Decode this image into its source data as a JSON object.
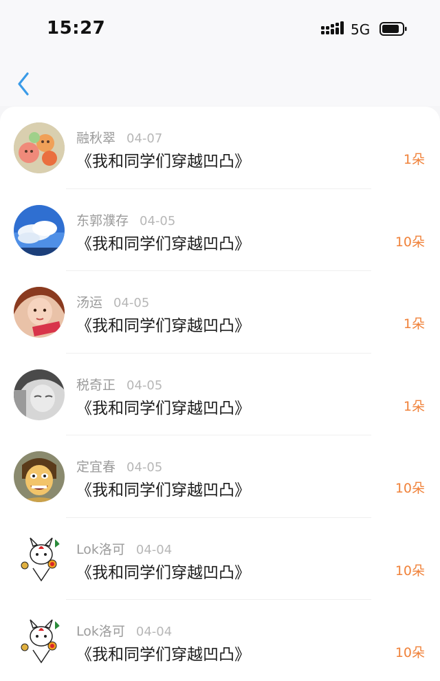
{
  "status_bar": {
    "time": "15:27",
    "network": "5G"
  },
  "nav": {
    "back_icon": "chevron-left-icon"
  },
  "colors": {
    "accent_back": "#3a9be8",
    "flower_count": "#f0823a",
    "username": "#9b9b9b",
    "date": "#b7b7b7"
  },
  "records": [
    {
      "username": "融秋翠",
      "date": "04-07",
      "title": "《我和同学们穿越凹凸》",
      "flowers": "1朵",
      "avatar": "avatar-1"
    },
    {
      "username": "东郭濮存",
      "date": "04-05",
      "title": "《我和同学们穿越凹凸》",
      "flowers": "10朵",
      "avatar": "avatar-2"
    },
    {
      "username": "汤运",
      "date": "04-05",
      "title": "《我和同学们穿越凹凸》",
      "flowers": "1朵",
      "avatar": "avatar-3"
    },
    {
      "username": "税奇正",
      "date": "04-05",
      "title": "《我和同学们穿越凹凸》",
      "flowers": "1朵",
      "avatar": "avatar-4"
    },
    {
      "username": "定宜春",
      "date": "04-05",
      "title": "《我和同学们穿越凹凸》",
      "flowers": "10朵",
      "avatar": "avatar-5"
    },
    {
      "username": "Lok洛可",
      "date": "04-04",
      "title": "《我和同学们穿越凹凸》",
      "flowers": "10朵",
      "avatar": "avatar-6"
    },
    {
      "username": "Lok洛可",
      "date": "04-04",
      "title": "《我和同学们穿越凹凸》",
      "flowers": "10朵",
      "avatar": "avatar-7"
    }
  ]
}
